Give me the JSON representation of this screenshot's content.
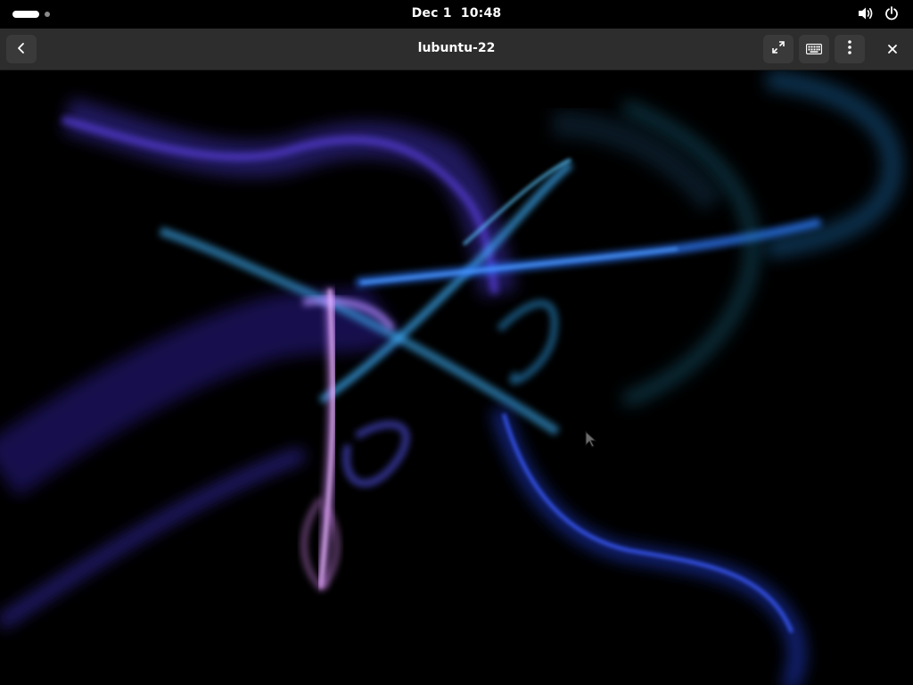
{
  "topbar": {
    "date": "Dec 1",
    "time": "10:48",
    "icons": [
      "volume-icon",
      "power-icon"
    ]
  },
  "headerbar": {
    "title": "lubuntu-22",
    "buttons": [
      "back-icon",
      "fullscreen-icon",
      "keyboard-icon",
      "menu-icon",
      "close-icon"
    ]
  },
  "colors": {
    "topbar_bg": "#000000",
    "headerbar_bg": "#2d2d2d",
    "button_bg": "#3a3a3a",
    "text": "#ffffff",
    "ribbon_blue": "#3a6cff",
    "ribbon_cyan": "#3fb2ff",
    "ribbon_purple": "#5a3fd6",
    "ribbon_pink": "#e9a3ff"
  }
}
